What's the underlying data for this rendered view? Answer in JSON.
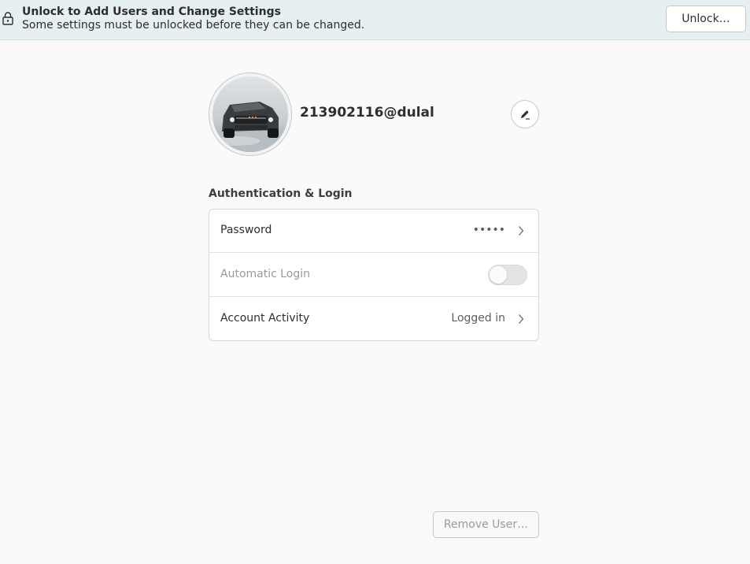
{
  "infobar": {
    "title": "Unlock to Add Users and Change Settings",
    "subtitle": "Some settings must be unlocked before they can be changed.",
    "unlock_label": "Unlock…",
    "lock_icon": "lock-icon"
  },
  "user": {
    "name": "213902116@dulal",
    "avatar": "avatar-photo-pickup-truck",
    "edit_icon": "pencil-icon"
  },
  "auth": {
    "section_title": "Authentication & Login",
    "rows": [
      {
        "label": "Password",
        "value": "•••••",
        "icon": "chevron-right-icon"
      },
      {
        "label": "Automatic Login",
        "toggle_on": false,
        "enabled": false
      },
      {
        "label": "Account Activity",
        "value": "Logged in",
        "icon": "chevron-right-icon"
      }
    ]
  },
  "footer": {
    "remove_label": "Remove User…",
    "remove_enabled": false
  }
}
